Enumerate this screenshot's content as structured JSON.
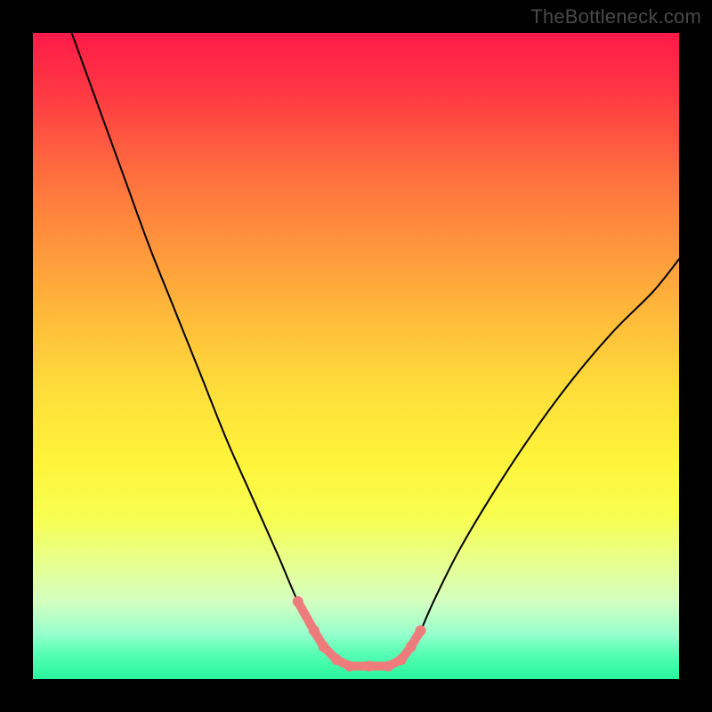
{
  "watermark": "TheBottleneck.com",
  "chart_data": {
    "type": "line",
    "title": "",
    "xlabel": "",
    "ylabel": "",
    "xlim": [
      0,
      100
    ],
    "ylim": [
      0,
      100
    ],
    "background_gradient": {
      "top_color": "#ff1a48",
      "mid_color": "#fff33a",
      "bottom_color": "#27f59e"
    },
    "series": [
      {
        "name": "curve (black)",
        "color": "#000000",
        "x": [
          6,
          10,
          14,
          18,
          22,
          26,
          30,
          34,
          38,
          41,
          43.5,
          45,
          47,
          49,
          52,
          55,
          57,
          58.5,
          60,
          62,
          66,
          72,
          78,
          84,
          90,
          96,
          100
        ],
        "y": [
          100,
          89,
          78,
          67,
          57,
          47,
          37,
          28,
          19,
          12,
          7.5,
          5,
          3,
          2,
          2,
          2,
          3,
          5,
          7.5,
          12,
          20,
          30,
          39,
          47,
          54,
          60,
          65
        ]
      },
      {
        "name": "valley-highlight (pink)",
        "color": "#f07a7a",
        "x": [
          41,
          43.5,
          45,
          47,
          49,
          52,
          55,
          57,
          58.5,
          60
        ],
        "y": [
          12,
          7.5,
          5,
          3,
          2,
          2,
          2,
          3,
          5,
          7.5
        ]
      }
    ]
  }
}
